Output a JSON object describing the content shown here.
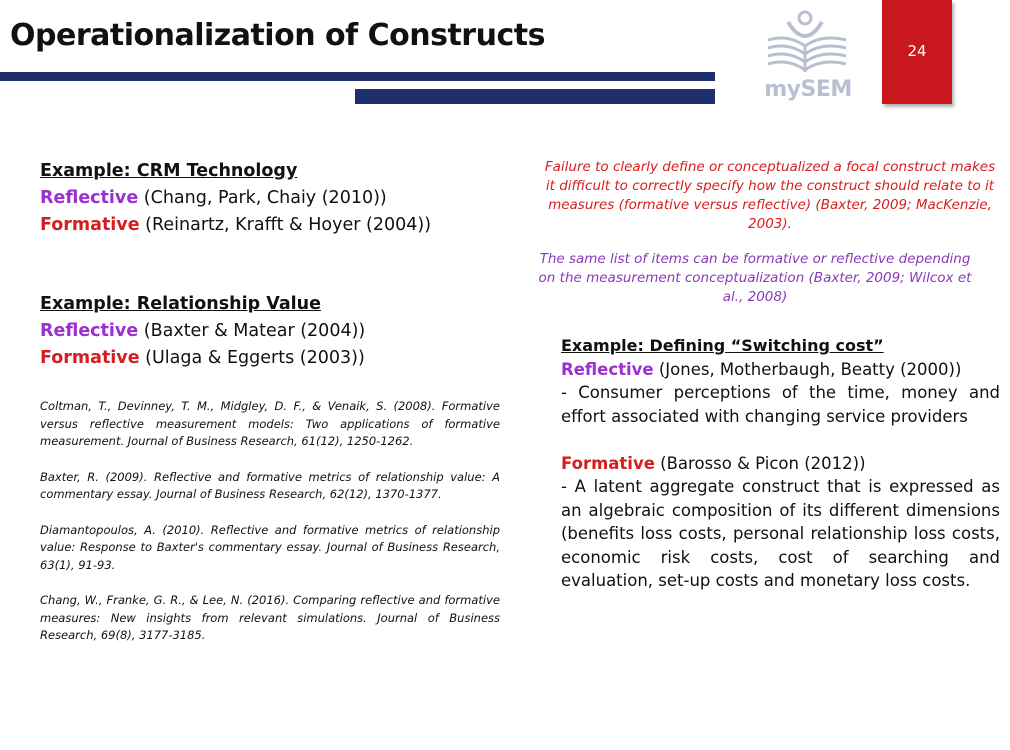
{
  "slide": {
    "title": "Operationalization of Constructs",
    "page_number": "24",
    "logo_text": "mySEM"
  },
  "colors": {
    "navy_bar": "#1f2f6e",
    "page_box": "#c9171e",
    "reflective": "#9b2fd1",
    "formative": "#d61e1e",
    "logo": "#b9bfd2"
  },
  "example_crm": {
    "heading": "Example: CRM Technology",
    "reflective_label": "Reflective",
    "reflective_ref": "(Chang, Park, Chaiy (2010))",
    "formative_label": "Formative",
    "formative_ref": "(Reinartz, Krafft & Hoyer (2004))"
  },
  "example_rv": {
    "heading": "Example: Relationship Value",
    "reflective_label": "Reflective",
    "reflective_ref": "(Baxter & Matear (2004))",
    "formative_label": "Formative",
    "formative_ref": "(Ulaga & Eggerts (2003))"
  },
  "references": [
    "Coltman, T., Devinney, T. M., Midgley, D. F., & Venaik, S. (2008). Formative versus reflective measurement models: Two applications of formative measurement. Journal of Business Research, 61(12), 1250-1262.",
    "Baxter, R. (2009). Reflective and formative metrics of relationship value: A commentary essay. Journal of Business Research, 62(12), 1370-1377.",
    "Diamantopoulos, A. (2010). Reflective and formative metrics of relationship value: Response to Baxter's commentary essay. Journal of Business Research, 63(1), 91-93.",
    "Chang, W., Franke, G. R., & Lee, N. (2016). Comparing reflective and formative measures: New insights from relevant simulations. Journal of Business Research, 69(8), 3177-3185."
  ],
  "quotes": {
    "q1": "Failure to clearly define or conceptualized a focal construct makes it difficult to correctly specify how the construct should relate to it measures (formative versus reflective) (Baxter, 2009; MacKenzie, 2003).",
    "q2": "The same list of items can be formative or reflective depending on the measurement conceptualization (Baxter, 2009; Wilcox et al., 2008)"
  },
  "switching_cost": {
    "heading": "Example: Defining “Switching cost”",
    "reflective_label": "Reflective",
    "reflective_ref": "(Jones, Motherbaugh, Beatty (2000))",
    "reflective_desc": "- Consumer perceptions of the time, money and effort associated with changing service providers",
    "formative_label": "Formative",
    "formative_ref": "(Barosso & Picon (2012))",
    "formative_desc": "- A latent aggregate construct that is expressed as an algebraic composition of its different dimensions (benefits loss costs, personal relationship loss costs, economic risk costs, cost of searching and evaluation, set-up costs and monetary loss costs."
  }
}
